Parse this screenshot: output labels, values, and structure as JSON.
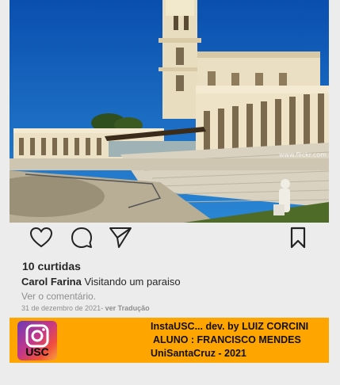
{
  "post": {
    "image_alt": "Santuário de Fátima",
    "watermark": "www.flickr.com",
    "likes": "10 curtidas",
    "username": "Carol Farina",
    "caption": " Visitando um paraiso",
    "view_comments": "Ver o comentário.",
    "date": "31 de dezembro de 2021",
    "date_sep": "- ",
    "translate": "ver Tradução"
  },
  "actions": {
    "like_icon": "heart-icon",
    "comment_icon": "comment-icon",
    "share_icon": "paper-plane-icon",
    "save_icon": "bookmark-icon"
  },
  "footer": {
    "logo_text": "USC",
    "line1": "InstaUSC... dev. by LUIZ CORCINI",
    "line2": "ALUNO : FRANCISCO MENDES",
    "line3": "UniSantaCruz - 2021",
    "background": "#ffa500"
  }
}
